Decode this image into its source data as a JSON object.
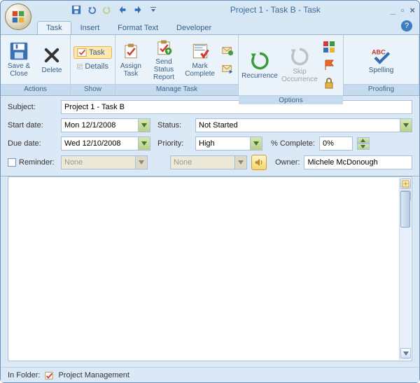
{
  "window_title": "Project 1 - Task B  -  Task",
  "qat": {
    "save": "Save",
    "undo": "Undo",
    "redo": "Redo",
    "prev": "Previous",
    "next": "Next"
  },
  "tabs": [
    "Task",
    "Insert",
    "Format Text",
    "Developer"
  ],
  "ribbon": {
    "actions": {
      "label": "Actions",
      "save_close": "Save &\nClose",
      "delete": "Delete"
    },
    "show": {
      "label": "Show",
      "task": "Task",
      "details": "Details"
    },
    "manage": {
      "label": "Manage Task",
      "assign": "Assign\nTask",
      "send_status": "Send Status\nReport",
      "mark_complete": "Mark\nComplete"
    },
    "options": {
      "label": "Options",
      "recurrence": "Recurrence",
      "skip": "Skip\nOccurrence"
    },
    "proofing": {
      "label": "Proofing",
      "spelling": "Spelling"
    }
  },
  "form": {
    "subject_label": "Subject:",
    "subject": "Project 1 - Task B",
    "start_label": "Start date:",
    "start": "Mon 12/1/2008",
    "due_label": "Due date:",
    "due": "Wed 12/10/2008",
    "status_label": "Status:",
    "status": "Not Started",
    "priority_label": "Priority:",
    "priority": "High",
    "pct_label": "% Complete:",
    "pct": "0%",
    "reminder_label": "Reminder:",
    "reminder_date": "None",
    "reminder_time": "None",
    "owner_label": "Owner:",
    "owner": "Michele McDonough"
  },
  "status": {
    "in_folder_label": "In Folder:",
    "folder": "Project Management"
  }
}
